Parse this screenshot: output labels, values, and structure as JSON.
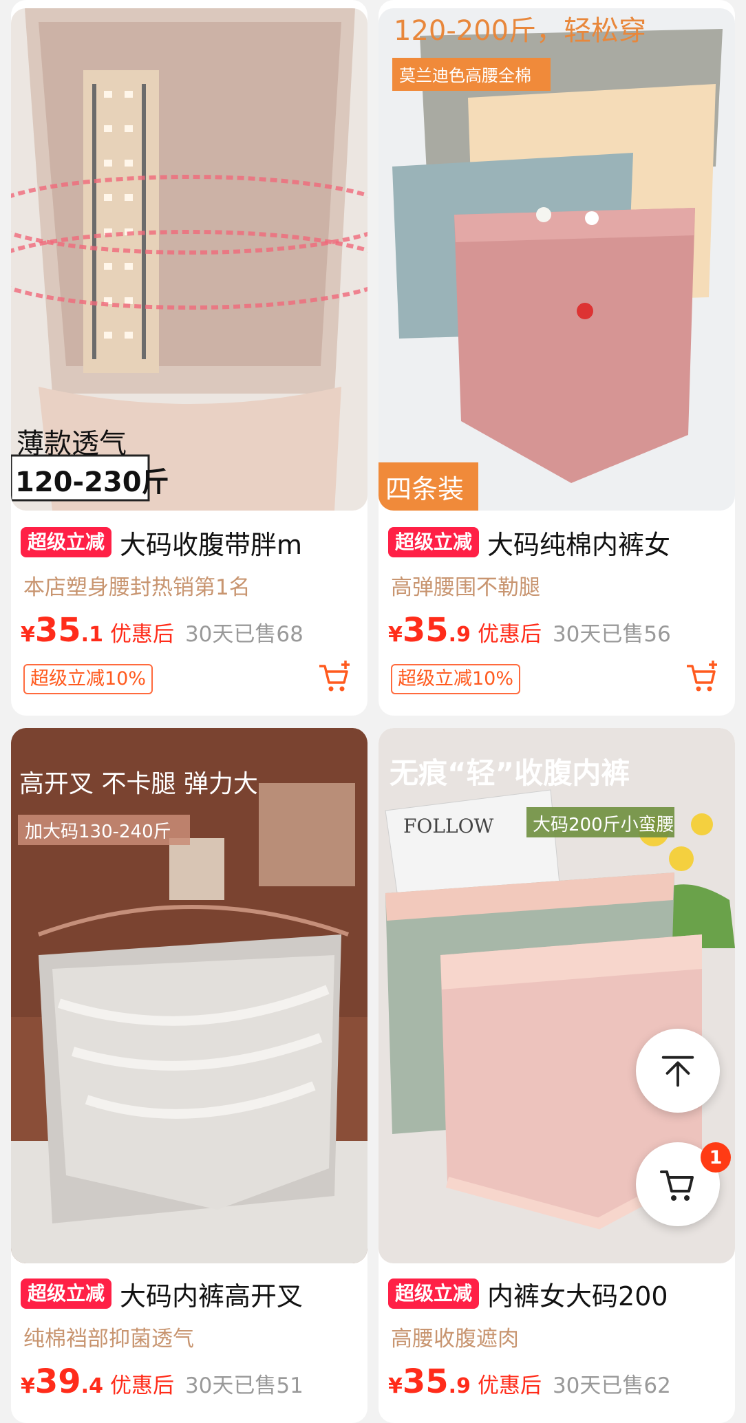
{
  "products": [
    {
      "tag": "超级立减",
      "title": "大码收腹带胖m",
      "subtitle": "本店塑身腰封热销第1名",
      "price_int": "35",
      "price_dec": ".1",
      "currency": "¥",
      "price_note": "优惠后",
      "sold": "30天已售68",
      "coupon": "超级立减10%",
      "image_texts": {
        "line1": "薄款透气",
        "line2": "120-230斤"
      }
    },
    {
      "tag": "超级立减",
      "title": "大码纯棉内裤女",
      "subtitle": "高弹腰围不勒腿",
      "price_int": "35",
      "price_dec": ".9",
      "currency": "¥",
      "price_note": "优惠后",
      "sold": "30天已售56",
      "coupon": "超级立减10%",
      "image_texts": {
        "headline": "120-200斤，轻松穿",
        "badge": "莫兰迪色高腰全棉",
        "corner": "四条装"
      }
    },
    {
      "tag": "超级立减",
      "title": "大码内裤高开叉",
      "subtitle": "纯棉裆部抑菌透气",
      "price_int": "39",
      "price_dec": ".4",
      "currency": "¥",
      "price_note": "优惠后",
      "sold": "30天已售51",
      "image_texts": {
        "headline": "高开叉  不卡腿  弹力大",
        "badge": "加大码130-240斤"
      }
    },
    {
      "tag": "超级立减",
      "title": "内裤女大码200",
      "subtitle": "高腰收腹遮肉",
      "price_int": "35",
      "price_dec": ".9",
      "currency": "¥",
      "price_note": "优惠后",
      "sold": "30天已售62",
      "image_texts": {
        "headline": "无痕“轻”收腹内裤",
        "badge": "大码200斤小蛮腰",
        "book": "FOLLOW"
      }
    }
  ],
  "floating": {
    "cart_count": "1"
  },
  "colors": {
    "accent": "#ff2c1a",
    "tag_bg": "#ff2046",
    "subtitle": "#c89570"
  },
  "icons": [
    "add-to-cart-icon",
    "back-to-top-icon",
    "cart-icon"
  ]
}
